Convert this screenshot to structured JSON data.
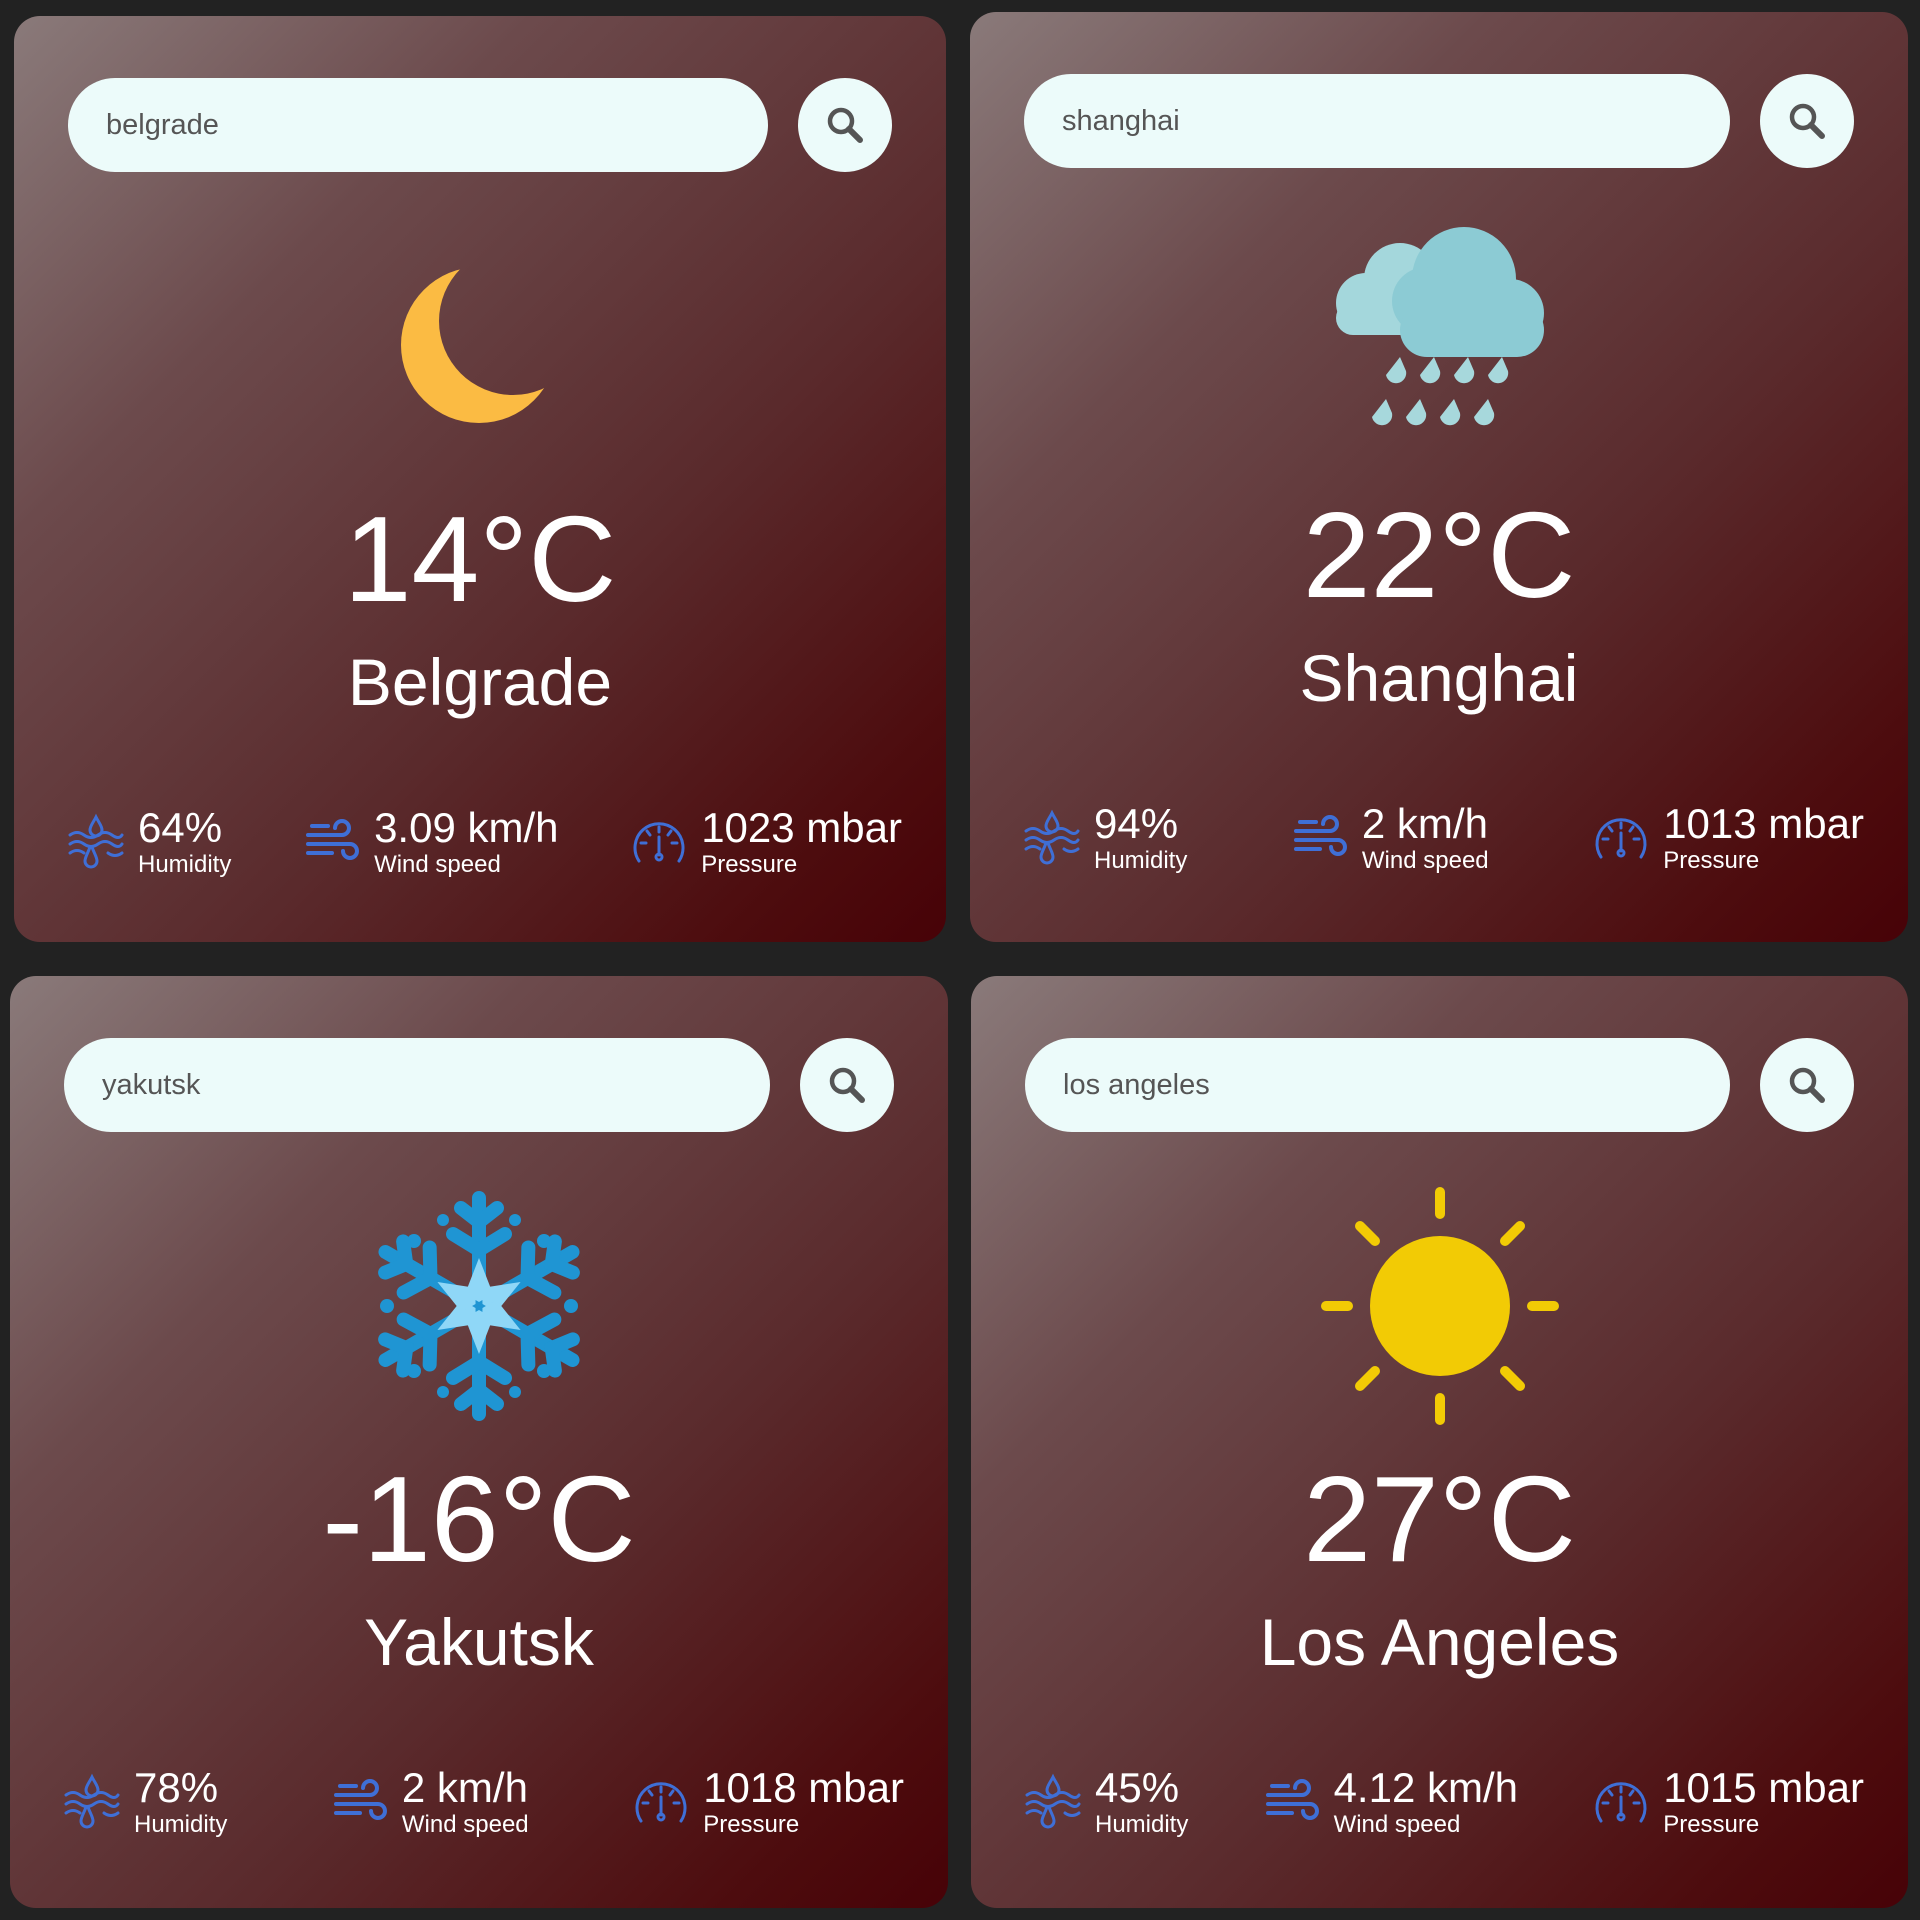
{
  "colors": {
    "page_background": "#222222",
    "card_gradient_start": "#8a7a7a",
    "card_gradient_end": "#470207",
    "search_background": "#ecfbfa",
    "stat_icon_color": "#3f6fd6",
    "moon_color": "#fbbb43",
    "sun_color": "#f2cb05",
    "cloud_color": "#8ccbd4",
    "snowflake_color": "#1f95d3"
  },
  "cards": [
    {
      "search": {
        "value": "belgrade",
        "icon": "search-icon"
      },
      "weather_icon": "moon-icon",
      "temperature": "14°C",
      "city": "Belgrade",
      "humidity": {
        "value": "64%",
        "label": "Humidity",
        "icon": "humidity-icon"
      },
      "wind": {
        "value": "3.09 km/h",
        "label": "Wind speed",
        "icon": "wind-icon"
      },
      "pressure": {
        "value": "1023 mbar",
        "label": "Pressure",
        "icon": "pressure-gauge-icon"
      }
    },
    {
      "search": {
        "value": "shanghai",
        "icon": "search-icon"
      },
      "weather_icon": "rain-cloud-icon",
      "temperature": "22°C",
      "city": "Shanghai",
      "humidity": {
        "value": "94%",
        "label": "Humidity",
        "icon": "humidity-icon"
      },
      "wind": {
        "value": "2 km/h",
        "label": "Wind speed",
        "icon": "wind-icon"
      },
      "pressure": {
        "value": "1013 mbar",
        "label": "Pressure",
        "icon": "pressure-gauge-icon"
      }
    },
    {
      "search": {
        "value": "yakutsk",
        "icon": "search-icon"
      },
      "weather_icon": "snowflake-icon",
      "temperature": "-16°C",
      "city": "Yakutsk",
      "humidity": {
        "value": "78%",
        "label": "Humidity",
        "icon": "humidity-icon"
      },
      "wind": {
        "value": "2 km/h",
        "label": "Wind speed",
        "icon": "wind-icon"
      },
      "pressure": {
        "value": "1018 mbar",
        "label": "Pressure",
        "icon": "pressure-gauge-icon"
      }
    },
    {
      "search": {
        "value": "los angeles",
        "icon": "search-icon"
      },
      "weather_icon": "sun-icon",
      "temperature": "27°C",
      "city": "Los Angeles",
      "humidity": {
        "value": "45%",
        "label": "Humidity",
        "icon": "humidity-icon"
      },
      "wind": {
        "value": "4.12 km/h",
        "label": "Wind speed",
        "icon": "wind-icon"
      },
      "pressure": {
        "value": "1015 mbar",
        "label": "Pressure",
        "icon": "pressure-gauge-icon"
      }
    }
  ]
}
